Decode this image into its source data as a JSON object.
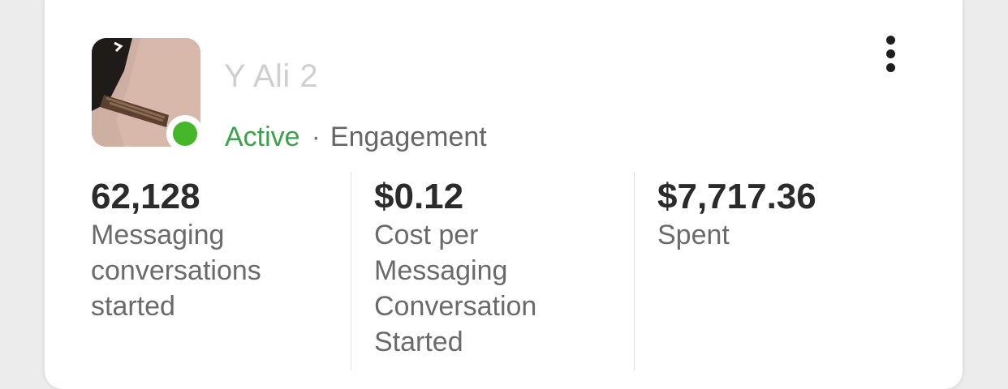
{
  "campaign": {
    "name": "Y      Ali 2",
    "status": "Active",
    "separator": "·",
    "objective": "Engagement",
    "status_color": "#45b52a"
  },
  "menu": {
    "icon": "more-vertical-icon"
  },
  "metrics": [
    {
      "value": "62,128",
      "label": "Messaging conversations started"
    },
    {
      "value": "$0.12",
      "label": "Cost per Messaging Conversation Started"
    },
    {
      "value": "$7,717.36",
      "label": "Spent"
    }
  ]
}
